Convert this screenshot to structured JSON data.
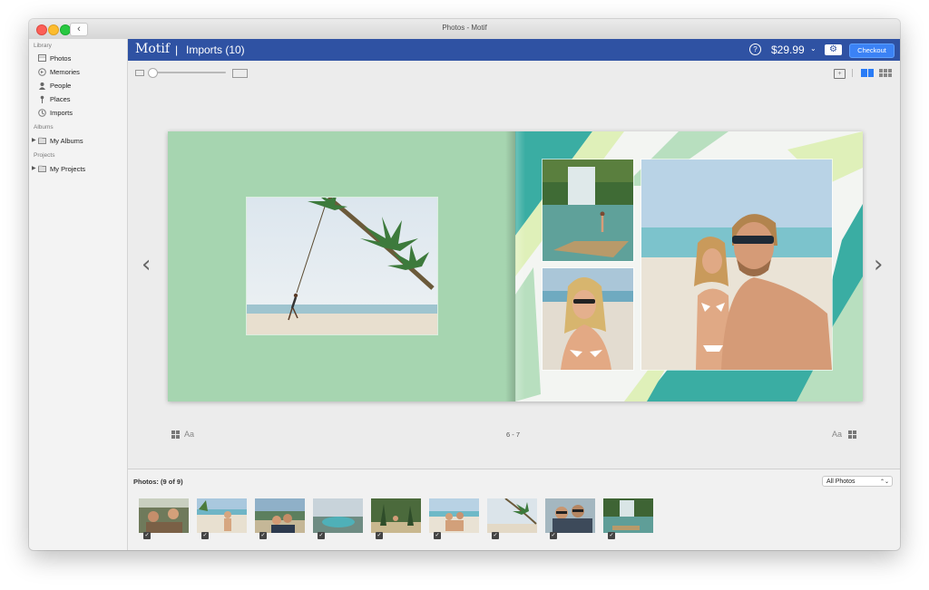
{
  "window": {
    "title": "Photos - Motif",
    "back_glyph": "‹"
  },
  "sidebar": {
    "sections": [
      {
        "title": "Library",
        "items": [
          {
            "label": "Photos",
            "icon": "photos-icon"
          },
          {
            "label": "Memories",
            "icon": "memories-icon"
          },
          {
            "label": "People",
            "icon": "people-icon"
          },
          {
            "label": "Places",
            "icon": "places-icon"
          },
          {
            "label": "Imports",
            "icon": "imports-icon"
          }
        ]
      },
      {
        "title": "Albums",
        "items": [
          {
            "label": "My Albums",
            "icon": "folder-icon"
          }
        ]
      },
      {
        "title": "Projects",
        "items": [
          {
            "label": "My Projects",
            "icon": "folder-icon"
          }
        ]
      }
    ]
  },
  "header": {
    "brand": "Motif",
    "separator": "|",
    "title": "Imports (10)",
    "help_glyph": "?",
    "price": "$29.99",
    "price_chevron": "⌄",
    "settings_glyph": "⚙",
    "checkout_label": "Checkout",
    "color": "#2f52a3",
    "checkout_color": "#3b82f5"
  },
  "toolbar": {
    "zoom_level": 0.0,
    "active_view": "two-page",
    "add_page_glyph": "+"
  },
  "book": {
    "left_page_color": "#a6d5b0",
    "right_accent_colors": [
      "#3aada3",
      "#dff0b9",
      "#b8dfbf"
    ],
    "pages_label": "6 - 7",
    "font_label": "Aa",
    "prev_glyph": "‹",
    "next_glyph": "›"
  },
  "photos_panel": {
    "title": "Photos: (9 of 9)",
    "filter_value": "All Photos",
    "filter_glyph": "⌃⌄",
    "check_glyph": "✓",
    "thumbnail_count": 9
  }
}
